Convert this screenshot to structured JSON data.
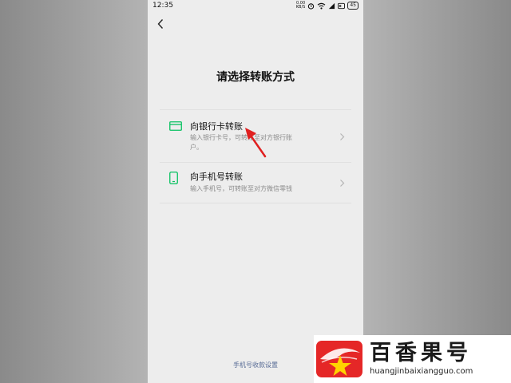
{
  "status_bar": {
    "time": "12:35",
    "net_speed_value": "0.00",
    "net_speed_unit": "KB/S",
    "battery": "45",
    "icons": [
      "alarm-icon",
      "wifi-icon",
      "signal-icon",
      "hd-icon",
      "battery-icon"
    ]
  },
  "page": {
    "title": "请选择转账方式",
    "options": [
      {
        "icon": "bank-card-icon",
        "title": "向银行卡转账",
        "description": "输入银行卡号，可转账至对方银行账户。"
      },
      {
        "icon": "phone-icon",
        "title": "向手机号转账",
        "description": "输入手机号，可转账至对方微信零钱"
      }
    ],
    "footer_link": "手机号收款设置"
  },
  "annotation": {
    "arrow_color": "#e02020"
  },
  "watermark": {
    "name": "百香果号",
    "url": "huangjinbaixiangguo.com",
    "brand_color": "#e52727",
    "star_color": "#ffd400"
  },
  "colors": {
    "accent_green": "#07c160",
    "link_blue": "#576b95",
    "page_bg": "#ededed"
  }
}
